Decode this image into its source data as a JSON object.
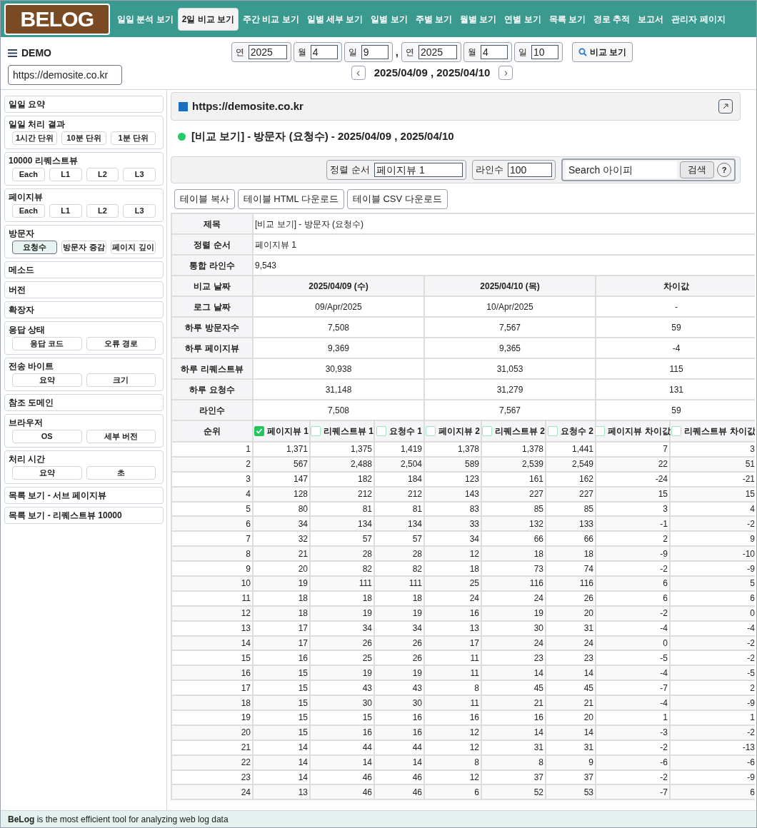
{
  "logo": "BELOG",
  "nav": [
    {
      "label": "일일 분석 보기",
      "selected": false
    },
    {
      "label": "2일 비교 보기",
      "selected": true
    },
    {
      "label": "주간 비교 보기",
      "selected": false
    },
    {
      "label": "일별 세부 보기",
      "selected": false
    },
    {
      "label": "일별 보기",
      "selected": false
    },
    {
      "label": "주별 보기",
      "selected": false
    },
    {
      "label": "월별 보기",
      "selected": false
    },
    {
      "label": "연별 보기",
      "selected": false
    },
    {
      "label": "목록 보기",
      "selected": false
    },
    {
      "label": "경로 추적",
      "selected": false
    },
    {
      "label": "보고서",
      "selected": false
    },
    {
      "label": "관리자 페이지",
      "selected": false
    }
  ],
  "site_menu": {
    "label": "DEMO",
    "site": "https://demosite.co.kr"
  },
  "date_fields": [
    {
      "label": "연",
      "value": "2025"
    },
    {
      "label": "월",
      "value": "4"
    },
    {
      "label": "일",
      "value": "9"
    },
    {
      "label": "연",
      "value": "2025"
    },
    {
      "label": "월",
      "value": "4"
    },
    {
      "label": "일",
      "value": "10"
    }
  ],
  "date_separator": ",",
  "compare_button": "비교 보기",
  "date_nav": {
    "prev": "‹",
    "range": "2025/04/09 , 2025/04/10",
    "next": "›"
  },
  "sidebar": [
    {
      "title": "일일 요약"
    },
    {
      "title": "일일 처리 결과",
      "buttons": [
        {
          "label": "1시간 단위",
          "selected": false
        },
        {
          "label": "10분 단위",
          "selected": false
        },
        {
          "label": "1분 단위",
          "selected": false
        }
      ]
    },
    {
      "title": "10000 리퀘스트뷰",
      "buttons": [
        {
          "label": "Each",
          "selected": false
        },
        {
          "label": "L1",
          "selected": false
        },
        {
          "label": "L2",
          "selected": false
        },
        {
          "label": "L3",
          "selected": false
        }
      ]
    },
    {
      "title": "페이지뷰",
      "buttons": [
        {
          "label": "Each",
          "selected": false
        },
        {
          "label": "L1",
          "selected": false
        },
        {
          "label": "L2",
          "selected": false
        },
        {
          "label": "L3",
          "selected": false
        }
      ]
    },
    {
      "title": "방문자",
      "buttons": [
        {
          "label": "요청수",
          "selected": true
        },
        {
          "label": "방문자 증감",
          "selected": false
        },
        {
          "label": "페이지 깊이",
          "selected": false
        }
      ]
    },
    {
      "title": "메소드"
    },
    {
      "title": "버전"
    },
    {
      "title": "확장자"
    },
    {
      "title": "응답 상태",
      "buttons": [
        {
          "label": "응답 코드",
          "selected": false
        },
        {
          "label": "오류 경로",
          "selected": false
        }
      ]
    },
    {
      "title": "전송 바이트",
      "buttons": [
        {
          "label": "요약",
          "selected": false
        },
        {
          "label": "크기",
          "selected": false
        }
      ]
    },
    {
      "title": "참조 도메인"
    },
    {
      "title": "브라우저",
      "buttons": [
        {
          "label": "OS",
          "selected": false
        },
        {
          "label": "세부 버전",
          "selected": false
        }
      ]
    },
    {
      "title": "처리 시간",
      "buttons": [
        {
          "label": "요약",
          "selected": false
        },
        {
          "label": "초",
          "selected": false
        }
      ]
    },
    {
      "title": "목록 보기 - 서브 페이지뷰"
    },
    {
      "title": "목록 보기 - 리퀘스트뷰 10000"
    }
  ],
  "site_header": "https://demosite.co.kr",
  "report_title": "[비교 보기] - 방문자 (요청수) - 2025/04/09 , 2025/04/10",
  "filters": {
    "sort_label": "정렬 순서",
    "sort_value": "페이지뷰 1",
    "lines_label": "라인수",
    "lines_value": "100",
    "search_placeholder": "Search 아이피",
    "search_button": "검색",
    "help": "?"
  },
  "table_buttons": [
    "테이블 복사",
    "테이블 HTML 다운로드",
    "테이블 CSV 다운로드"
  ],
  "summary": [
    [
      "제목",
      "[비교 보기] - 방문자 (요청수)"
    ],
    [
      "정렬 순서",
      "페이지뷰 1"
    ],
    [
      "통합 라인수",
      "9,543"
    ]
  ],
  "compare": [
    [
      "비교 날짜",
      "2025/04/09 (수)",
      "2025/04/10 (목)",
      "차이값"
    ],
    [
      "로그 날짜",
      "09/Apr/2025",
      "10/Apr/2025",
      "-"
    ],
    [
      "하루 방문자수",
      "7,508",
      "7,567",
      "59"
    ],
    [
      "하루 페이지뷰",
      "9,369",
      "9,365",
      "-4"
    ],
    [
      "하루 리퀘스트뷰",
      "30,938",
      "31,053",
      "115"
    ],
    [
      "하루 요청수",
      "31,148",
      "31,279",
      "131"
    ],
    [
      "라인수",
      "7,508",
      "7,567",
      "59"
    ]
  ],
  "columns": [
    {
      "label": "순위",
      "kind": "plain"
    },
    {
      "label": "페이지뷰 1",
      "kind": "check",
      "checked": true
    },
    {
      "label": "리퀘스트뷰 1",
      "kind": "check",
      "checked": false
    },
    {
      "label": "요청수 1",
      "kind": "check",
      "checked": false
    },
    {
      "label": "페이지뷰 2",
      "kind": "check",
      "checked": false
    },
    {
      "label": "리퀘스트뷰 2",
      "kind": "check",
      "checked": false
    },
    {
      "label": "요청수 2",
      "kind": "check",
      "checked": false
    },
    {
      "label": "페이지뷰 차이값",
      "kind": "check",
      "checked": false
    },
    {
      "label": "리퀘스트뷰 차이값",
      "kind": "check",
      "checked": false
    }
  ],
  "rows": [
    [
      "1",
      "1,371",
      "1,375",
      "1,419",
      "1,378",
      "1,378",
      "1,441",
      "7",
      "3"
    ],
    [
      "2",
      "567",
      "2,488",
      "2,504",
      "589",
      "2,539",
      "2,549",
      "22",
      "51"
    ],
    [
      "3",
      "147",
      "182",
      "184",
      "123",
      "161",
      "162",
      "-24",
      "-21"
    ],
    [
      "4",
      "128",
      "212",
      "212",
      "143",
      "227",
      "227",
      "15",
      "15"
    ],
    [
      "5",
      "80",
      "81",
      "81",
      "83",
      "85",
      "85",
      "3",
      "4"
    ],
    [
      "6",
      "34",
      "134",
      "134",
      "33",
      "132",
      "133",
      "-1",
      "-2"
    ],
    [
      "7",
      "32",
      "57",
      "57",
      "34",
      "66",
      "66",
      "2",
      "9"
    ],
    [
      "8",
      "21",
      "28",
      "28",
      "12",
      "18",
      "18",
      "-9",
      "-10"
    ],
    [
      "9",
      "20",
      "82",
      "82",
      "18",
      "73",
      "74",
      "-2",
      "-9"
    ],
    [
      "10",
      "19",
      "111",
      "111",
      "25",
      "116",
      "116",
      "6",
      "5"
    ],
    [
      "11",
      "18",
      "18",
      "18",
      "24",
      "24",
      "26",
      "6",
      "6"
    ],
    [
      "12",
      "18",
      "19",
      "19",
      "16",
      "19",
      "20",
      "-2",
      "0"
    ],
    [
      "13",
      "17",
      "34",
      "34",
      "13",
      "30",
      "31",
      "-4",
      "-4"
    ],
    [
      "14",
      "17",
      "26",
      "26",
      "17",
      "24",
      "24",
      "0",
      "-2"
    ],
    [
      "15",
      "16",
      "25",
      "26",
      "11",
      "23",
      "23",
      "-5",
      "-2"
    ],
    [
      "16",
      "15",
      "19",
      "19",
      "11",
      "14",
      "14",
      "-4",
      "-5"
    ],
    [
      "17",
      "15",
      "43",
      "43",
      "8",
      "45",
      "45",
      "-7",
      "2"
    ],
    [
      "18",
      "15",
      "30",
      "30",
      "11",
      "21",
      "21",
      "-4",
      "-9"
    ],
    [
      "19",
      "15",
      "15",
      "16",
      "16",
      "16",
      "20",
      "1",
      "1"
    ],
    [
      "20",
      "15",
      "16",
      "16",
      "12",
      "14",
      "14",
      "-3",
      "-2"
    ],
    [
      "21",
      "14",
      "44",
      "44",
      "12",
      "31",
      "31",
      "-2",
      "-13"
    ],
    [
      "22",
      "14",
      "14",
      "14",
      "8",
      "8",
      "9",
      "-6",
      "-6"
    ],
    [
      "23",
      "14",
      "46",
      "46",
      "12",
      "37",
      "37",
      "-2",
      "-9"
    ],
    [
      "24",
      "13",
      "46",
      "46",
      "6",
      "52",
      "53",
      "-7",
      "6"
    ]
  ],
  "footer": "**BeLog** is the most efficient tool for analyzing web log data"
}
